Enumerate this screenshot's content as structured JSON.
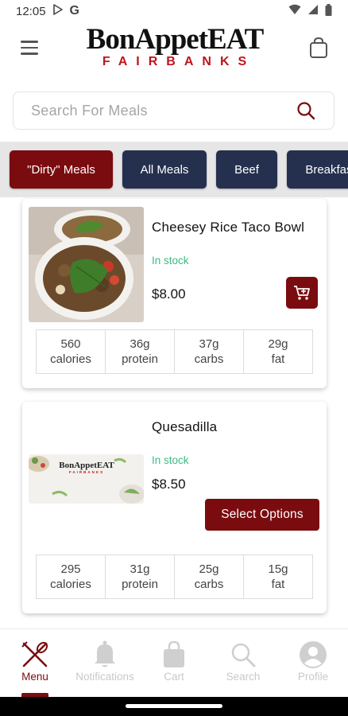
{
  "status_bar": {
    "time": "12:05",
    "g_icon": "G",
    "icons": [
      "play-store-icon",
      "google-icon",
      "wifi-icon",
      "signal-icon",
      "battery-icon"
    ]
  },
  "header": {
    "logo_main": "BonAppetEAT",
    "logo_sub": "FAIRBANKS",
    "menu_icon": "hamburger-icon",
    "cart_icon": "shopping-bag-icon"
  },
  "search": {
    "placeholder": "Search For Meals",
    "icon": "search-icon"
  },
  "colors": {
    "primary": "#7a0c10",
    "secondary": "#25304f",
    "in_stock": "#3dbb83",
    "inactive": "#c9c9c9"
  },
  "categories": [
    {
      "label": "\"Dirty\" Meals",
      "selected": true
    },
    {
      "label": "All Meals",
      "selected": false
    },
    {
      "label": "Beef",
      "selected": false
    },
    {
      "label": "Breakfast",
      "selected": false
    }
  ],
  "meals": [
    {
      "name": "Cheesey Rice Taco Bowl",
      "stock": "In stock",
      "price": "$8.00",
      "action": "add-to-cart",
      "nutrition": [
        {
          "value": "560",
          "label": "calories"
        },
        {
          "value": "36g",
          "label": "protein"
        },
        {
          "value": "37g",
          "label": "carbs"
        },
        {
          "value": "29g",
          "label": "fat"
        }
      ]
    },
    {
      "name": "Quesadilla",
      "stock": "In stock",
      "price": "$8.50",
      "action_label": "Select Options",
      "image_logo_text": "BonAppetEAT",
      "image_logo_sub": "FAIRBANKS",
      "nutrition": [
        {
          "value": "295",
          "label": "calories"
        },
        {
          "value": "31g",
          "label": "protein"
        },
        {
          "value": "25g",
          "label": "carbs"
        },
        {
          "value": "15g",
          "label": "fat"
        }
      ]
    }
  ],
  "bottom_nav": [
    {
      "label": "Menu",
      "icon": "utensils-icon",
      "active": true
    },
    {
      "label": "Notifications",
      "icon": "bell-icon",
      "active": false
    },
    {
      "label": "Cart",
      "icon": "shopping-bag-icon",
      "active": false
    },
    {
      "label": "Search",
      "icon": "search-icon",
      "active": false
    },
    {
      "label": "Profile",
      "icon": "user-circle-icon",
      "active": false
    }
  ]
}
